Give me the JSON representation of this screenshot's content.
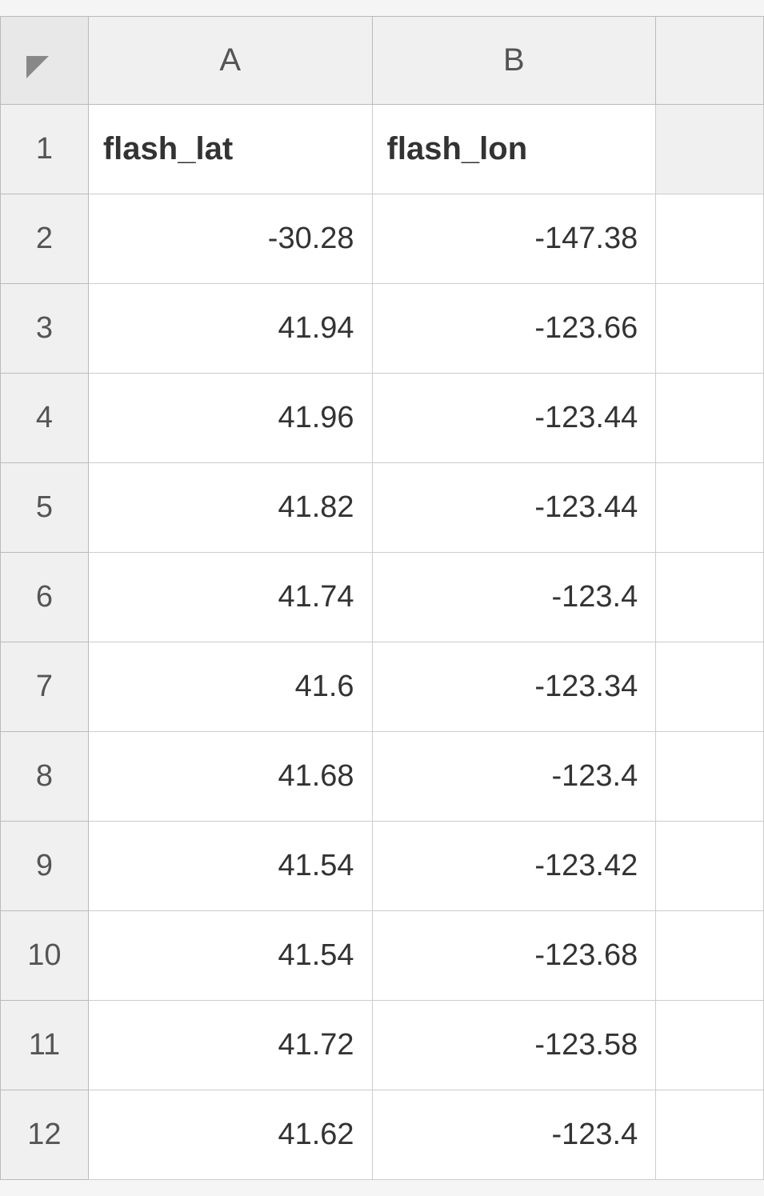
{
  "spreadsheet": {
    "columns": {
      "A_label": "A",
      "B_label": "B"
    },
    "header_row": {
      "col_a": "flash_lat",
      "col_b": "flash_lon"
    },
    "rows": [
      {
        "row_num": "2",
        "col_a": "-30.28",
        "col_b": "-147.38"
      },
      {
        "row_num": "3",
        "col_a": "41.94",
        "col_b": "-123.66"
      },
      {
        "row_num": "4",
        "col_a": "41.96",
        "col_b": "-123.44"
      },
      {
        "row_num": "5",
        "col_a": "41.82",
        "col_b": "-123.44"
      },
      {
        "row_num": "6",
        "col_a": "41.74",
        "col_b": "-123.4"
      },
      {
        "row_num": "7",
        "col_a": "41.6",
        "col_b": "-123.34"
      },
      {
        "row_num": "8",
        "col_a": "41.68",
        "col_b": "-123.4"
      },
      {
        "row_num": "9",
        "col_a": "41.54",
        "col_b": "-123.42"
      },
      {
        "row_num": "10",
        "col_a": "41.54",
        "col_b": "-123.68"
      },
      {
        "row_num": "11",
        "col_a": "41.72",
        "col_b": "-123.58"
      },
      {
        "row_num": "12",
        "col_a": "41.62",
        "col_b": "-123.4"
      }
    ]
  }
}
